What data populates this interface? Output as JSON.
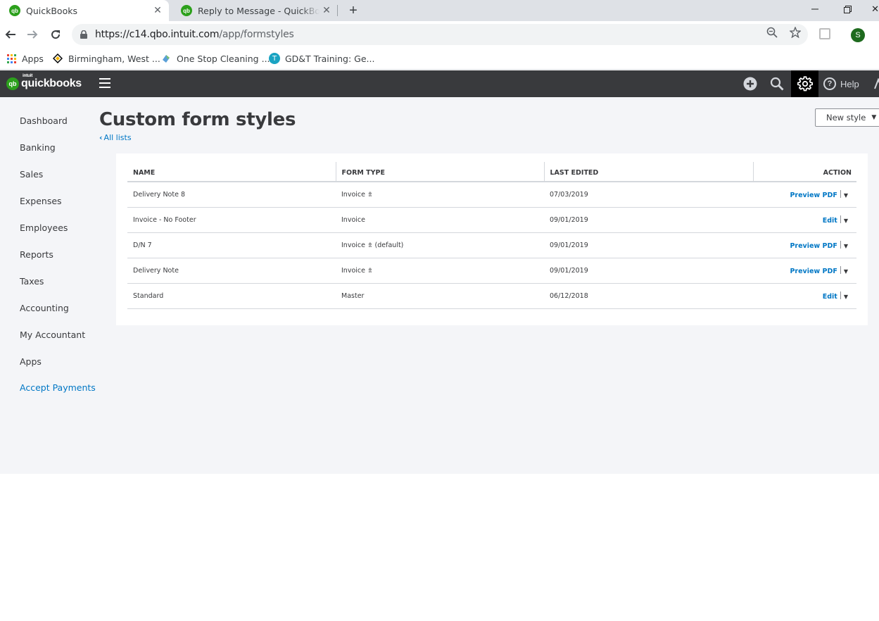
{
  "browser": {
    "tabs": [
      {
        "title": "QuickBooks",
        "favicon": "qb"
      },
      {
        "title": "Reply to Message - QuickBooks C",
        "favicon": "qb"
      }
    ],
    "url_host": "https://c14.qbo.intuit.com",
    "url_path": "/app/formstyles",
    "profile_initial": "S",
    "bookmarks": [
      {
        "label": "Apps"
      },
      {
        "label": "Birmingham, West ..."
      },
      {
        "label": "One Stop Cleaning ..."
      },
      {
        "label": "GD&T Training: Ge...",
        "badge": "T"
      }
    ]
  },
  "header": {
    "logo_intuit": "intuit",
    "logo_text": "quickbooks",
    "logo_badge": "qb",
    "help_label": "Help"
  },
  "sidebar": {
    "items": [
      {
        "label": "Dashboard"
      },
      {
        "label": "Banking"
      },
      {
        "label": "Sales"
      },
      {
        "label": "Expenses"
      },
      {
        "label": "Employees"
      },
      {
        "label": "Reports"
      },
      {
        "label": "Taxes"
      },
      {
        "label": "Accounting"
      },
      {
        "label": "My Accountant"
      },
      {
        "label": "Apps"
      },
      {
        "label": "Accept Payments"
      }
    ]
  },
  "page": {
    "title": "Custom form styles",
    "back_link": "All lists",
    "new_style_label": "New style"
  },
  "table": {
    "columns": [
      "NAME",
      "FORM TYPE",
      "LAST EDITED",
      "ACTION"
    ],
    "rows": [
      {
        "name": "Delivery Note 8",
        "form_type": "Invoice",
        "form_suffix": "",
        "has_icon": true,
        "last_edited": "07/03/2019",
        "action": "Preview PDF"
      },
      {
        "name": "Invoice - No Footer",
        "form_type": "Invoice",
        "form_suffix": "",
        "has_icon": false,
        "last_edited": "09/01/2019",
        "action": "Edit"
      },
      {
        "name": "D/N 7",
        "form_type": "Invoice",
        "form_suffix": "(default)",
        "has_icon": true,
        "last_edited": "09/01/2019",
        "action": "Preview PDF"
      },
      {
        "name": "Delivery Note",
        "form_type": "Invoice",
        "form_suffix": "",
        "has_icon": true,
        "last_edited": "09/01/2019",
        "action": "Preview PDF"
      },
      {
        "name": "Standard",
        "form_type": "Master",
        "form_suffix": "",
        "has_icon": false,
        "last_edited": "06/12/2018",
        "action": "Edit"
      }
    ]
  },
  "colors": {
    "brand_green": "#2ca01c",
    "header_bg": "#393a3d",
    "link_blue": "#0077c5",
    "body_bg": "#f4f5f8"
  }
}
